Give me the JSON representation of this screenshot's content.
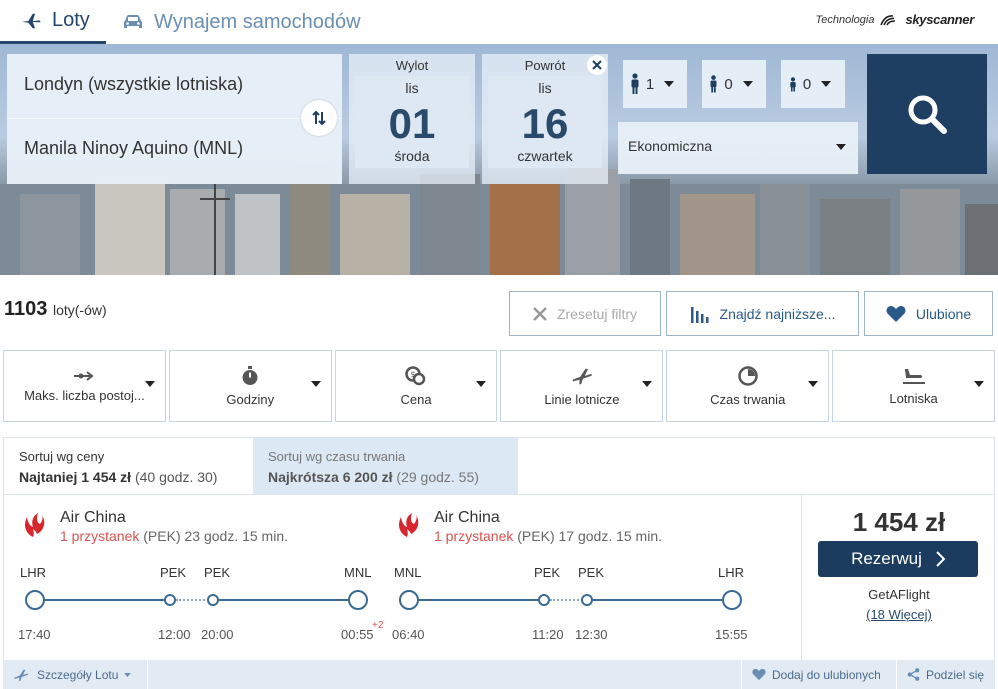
{
  "tabs": {
    "flights": "Loty",
    "car_rental": "Wynajem samochodów"
  },
  "powered_by": {
    "label": "Technologia",
    "brand": "skyscanner"
  },
  "search": {
    "origin": "Londyn (wszystkie lotniska)",
    "destination": "Manila Ninoy Aquino (MNL)",
    "departure": {
      "label": "Wylot",
      "month": "lis",
      "day": "01",
      "weekday": "środa"
    },
    "return": {
      "label": "Powrót",
      "month": "lis",
      "day": "16",
      "weekday": "czwartek"
    },
    "passengers": {
      "adults": "1",
      "children": "0",
      "infants": "0"
    },
    "cabin_class": "Ekonomiczna"
  },
  "results": {
    "count": "1103",
    "count_suffix": "loty(-ów)",
    "reset_filters": "Zresetuj filtry",
    "find_cheapest": "Znajdź najniższe...",
    "favorites": "Ulubione"
  },
  "filters": [
    {
      "label": "Maks. liczba postoj...",
      "icon": "stops-icon"
    },
    {
      "label": "Godziny",
      "icon": "stopwatch-icon"
    },
    {
      "label": "Cena",
      "icon": "coins-icon"
    },
    {
      "label": "Linie lotnicze",
      "icon": "plane-icon"
    },
    {
      "label": "Czas trwania",
      "icon": "clock-icon"
    },
    {
      "label": "Lotniska",
      "icon": "airport-icon"
    }
  ],
  "sort": {
    "price": {
      "title": "Sortuj wg ceny",
      "label": "Najtaniej",
      "value": "1 454 zł",
      "detail": "(40 godz. 30)"
    },
    "duration": {
      "title": "Sortuj wg czasu trwania",
      "label": "Najkrótsza",
      "value": "6 200 zł",
      "detail": "(29 godz. 55)"
    }
  },
  "flight": {
    "outbound": {
      "airline": "Air China",
      "stops": "1 przystanek",
      "via": "(PEK)",
      "duration": "23 godz. 15 min.",
      "from": "LHR",
      "stop_arr": "PEK",
      "stop_dep": "PEK",
      "to": "MNL",
      "dep_time": "17:40",
      "stop_arr_time": "12:00",
      "stop_dep_time": "20:00",
      "arr_time": "00:55",
      "day_offset": "+2"
    },
    "inbound": {
      "airline": "Air China",
      "stops": "1 przystanek",
      "via": "(PEK)",
      "duration": "17 godz. 15 min.",
      "from": "MNL",
      "stop_arr": "PEK",
      "stop_dep": "PEK",
      "to": "LHR",
      "dep_time": "06:40",
      "stop_arr_time": "11:20",
      "stop_dep_time": "12:30",
      "arr_time": "15:55"
    },
    "price": "1 454 zł",
    "book": "Rezerwuj",
    "agent": "GetAFlight",
    "more": "(18 Więcej)"
  },
  "footer": {
    "details": "Szczegóły Lotu",
    "add_favorite": "Dodaj do ulubionych",
    "share": "Podziel się"
  }
}
